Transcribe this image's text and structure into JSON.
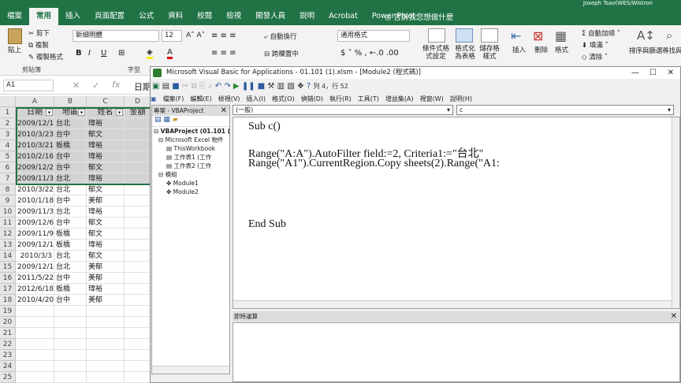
{
  "excel": {
    "tabs": [
      "檔案",
      "常用",
      "插入",
      "頁面配置",
      "公式",
      "資料",
      "校閱",
      "檢視",
      "開發人員",
      "說明",
      "Acrobat",
      "Power Pivot"
    ],
    "tell_me": "告訴我您想做什麼",
    "user": "Joseph Tsao(WES/Wistron",
    "ribbon": {
      "paste": "貼上",
      "cut": "剪下",
      "copy": "複製",
      "format_painter": "複製格式",
      "clipboard": "剪貼簿",
      "font_name": "新細明體",
      "font_size": "12",
      "font_group": "字型",
      "wrap": "自動換行",
      "merge": "跨欄置中",
      "number_format": "通用格式",
      "cond_format": "條件式格式設定",
      "format_table": "格式化為表格",
      "cell_styles": "儲存格樣式",
      "insert": "插入",
      "delete": "刪除",
      "format": "格式",
      "autosum": "自動加總",
      "fill": "填滿",
      "clear": "清除",
      "sort_filter": "排序與篩選",
      "find_select": "尋找與選取"
    },
    "name_box": "A1",
    "formula_bar_value": "日期",
    "columns": [
      "A",
      "B",
      "C",
      "D"
    ],
    "headers": [
      "日期",
      "地區",
      "姓名",
      "金額"
    ],
    "rows": [
      [
        "2009/12/11",
        "台北",
        "瑋裕"
      ],
      [
        "2010/3/23",
        "台中",
        "郁文"
      ],
      [
        "2010/3/21",
        "板橋",
        "瑋裕"
      ],
      [
        "2010/2/16",
        "台中",
        "瑋裕"
      ],
      [
        "2009/12/24",
        "台中",
        "郁文"
      ],
      [
        "2009/11/30",
        "台北",
        "瑋裕"
      ],
      [
        "2010/3/22",
        "台北",
        "郁文"
      ],
      [
        "2010/1/18",
        "台中",
        "美郁"
      ],
      [
        "2009/11/3",
        "台北",
        "瑋裕"
      ],
      [
        "2009/12/6",
        "台中",
        "郁文"
      ],
      [
        "2009/11/9",
        "板橋",
        "郁文"
      ],
      [
        "2009/12/19",
        "板橋",
        "瑋裕"
      ],
      [
        "2010/3/3",
        "台北",
        "郁文"
      ],
      [
        "2009/12/11",
        "台北",
        "美郁"
      ],
      [
        "2011/5/22",
        "台中",
        "美郁"
      ],
      [
        "2012/6/18",
        "板橋",
        "瑋裕"
      ],
      [
        "2010/4/20",
        "台中",
        "美郁"
      ]
    ],
    "row_numbers": [
      "1",
      "2",
      "3",
      "4",
      "5",
      "6",
      "7",
      "8",
      "9",
      "10",
      "11",
      "12",
      "13",
      "14",
      "15",
      "16",
      "17",
      "18",
      "19",
      "20",
      "21",
      "22",
      "23",
      "24",
      "25"
    ]
  },
  "vbe": {
    "title": "Microsoft Visual Basic for Applications - 01.101 (1).xlsm - [Module2 (程式碼)]",
    "cursor_pos": "列 4，行 52",
    "menus": [
      "檔案(F)",
      "編輯(E)",
      "檢視(V)",
      "插入(I)",
      "格式(O)",
      "偵錯(D)",
      "執行(R)",
      "工具(T)",
      "增益集(A)",
      "視窗(W)",
      "說明(H)"
    ],
    "project_title": "專案 - VBAProject",
    "tree": [
      "VBAProject (01.101 (",
      "Microsoft Excel 物件",
      "ThisWorkbook",
      "工作表1 (工作",
      "工作表2 (工作",
      "模組",
      "Module1",
      "Module2"
    ],
    "object_combo": "(一般)",
    "proc_combo": "c",
    "code": [
      "Sub c()",
      "",
      "Range(\"A:A\").AutoFilter field:=2, Criteria1:=\"台北\"",
      "Range(\"A1\").CurrentRegion.Copy sheets(2).Range(\"A1:",
      "",
      "",
      "",
      "",
      "End Sub"
    ],
    "immediate_title": "即時運算"
  },
  "colors": {
    "excel_green": "#217346",
    "selection": "#d3d3d3"
  }
}
